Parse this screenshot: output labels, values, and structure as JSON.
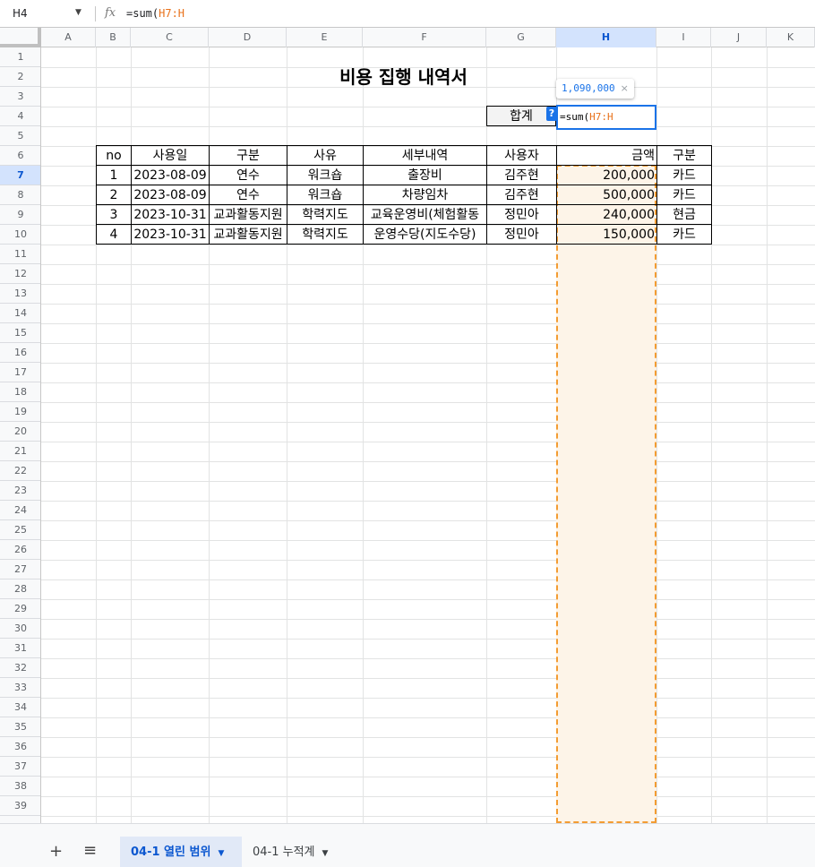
{
  "formula_bar": {
    "cell_ref": "H4",
    "formula_prefix": "=sum(",
    "formula_ref": "H7:H"
  },
  "columns": [
    "A",
    "B",
    "C",
    "D",
    "E",
    "F",
    "G",
    "H",
    "I",
    "J",
    "K"
  ],
  "selected_column": "H",
  "rows_visible": [
    "1",
    "2",
    "3",
    "4",
    "5",
    "6",
    "7",
    "8",
    "9",
    "10",
    "11",
    "12",
    "13",
    "14",
    "15",
    "16",
    "17",
    "18",
    "19",
    "20",
    "21",
    "22",
    "23",
    "24",
    "25",
    "26",
    "27",
    "28",
    "29",
    "30",
    "31",
    "32",
    "33",
    "34",
    "35",
    "36",
    "37",
    "38",
    "39"
  ],
  "selected_row": "7",
  "sheet": {
    "title": "비용 집행 내역서",
    "total_label": "합계",
    "help_badge": "?",
    "editor_prefix": "=sum(",
    "editor_ref": "H7:H",
    "tooltip_value": "1,090,000",
    "tooltip_close": "×",
    "headers": [
      "no",
      "사용일",
      "구분",
      "사유",
      "세부내역",
      "사용자",
      "금액",
      "구분"
    ],
    "rows": [
      [
        "1",
        "2023-08-09",
        "연수",
        "워크숍",
        "출장비",
        "김주현",
        "200,000",
        "카드"
      ],
      [
        "2",
        "2023-08-09",
        "연수",
        "워크숍",
        "차량임차",
        "김주현",
        "500,000",
        "카드"
      ],
      [
        "3",
        "2023-10-31",
        "교과활동지원",
        "학력지도",
        "교육운영비(체험활동",
        "정민아",
        "240,000",
        "현금"
      ],
      [
        "4",
        "2023-10-31",
        "교과활동지원",
        "학력지도",
        "운영수당(지도수당)",
        "정민아",
        "150,000",
        "카드"
      ]
    ]
  },
  "bottom_bar": {
    "add_sheet": "+",
    "all_sheets": "≡",
    "tabs": [
      {
        "label": "04-1 열린 범위",
        "active": true
      },
      {
        "label": "04-1 누적계",
        "active": false
      }
    ],
    "tab_arrow": "▼"
  }
}
